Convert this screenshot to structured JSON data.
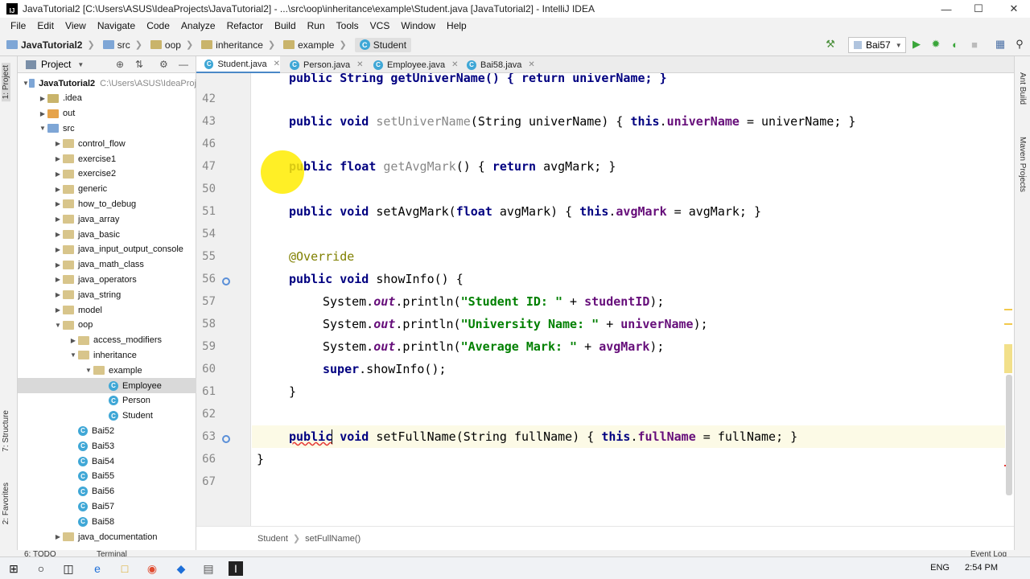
{
  "window": {
    "title": "JavaTutorial2 [C:\\Users\\ASUS\\IdeaProjects\\JavaTutorial2] - ...\\src\\oop\\inheritance\\example\\Student.java [JavaTutorial2] - IntelliJ IDEA",
    "app_icon_label": "IJ"
  },
  "menu": [
    "File",
    "Edit",
    "View",
    "Navigate",
    "Code",
    "Analyze",
    "Refactor",
    "Build",
    "Run",
    "Tools",
    "VCS",
    "Window",
    "Help"
  ],
  "navbar": {
    "crumbs": [
      "JavaTutorial2",
      "src",
      "oop",
      "inheritance",
      "example",
      "Student"
    ],
    "run_config": "Bai57"
  },
  "project_panel": {
    "title": "Project",
    "tree": [
      {
        "label": "JavaTutorial2",
        "suffix": "C:\\Users\\ASUS\\IdeaProj",
        "depth": 0,
        "type": "project",
        "open": true
      },
      {
        "label": ".idea",
        "depth": 1,
        "type": "dir",
        "open": false
      },
      {
        "label": "out",
        "depth": 1,
        "type": "orange",
        "open": false
      },
      {
        "label": "src",
        "depth": 1,
        "type": "src",
        "open": true
      },
      {
        "label": "control_flow",
        "depth": 2,
        "type": "pkg",
        "open": false
      },
      {
        "label": "exercise1",
        "depth": 2,
        "type": "pkg",
        "open": false
      },
      {
        "label": "exercise2",
        "depth": 2,
        "type": "pkg",
        "open": false
      },
      {
        "label": "generic",
        "depth": 2,
        "type": "pkg",
        "open": false
      },
      {
        "label": "how_to_debug",
        "depth": 2,
        "type": "pkg",
        "open": false
      },
      {
        "label": "java_array",
        "depth": 2,
        "type": "pkg",
        "open": false
      },
      {
        "label": "java_basic",
        "depth": 2,
        "type": "pkg",
        "open": false
      },
      {
        "label": "java_input_output_console",
        "depth": 2,
        "type": "pkg",
        "open": false
      },
      {
        "label": "java_math_class",
        "depth": 2,
        "type": "pkg",
        "open": false
      },
      {
        "label": "java_operators",
        "depth": 2,
        "type": "pkg",
        "open": false
      },
      {
        "label": "java_string",
        "depth": 2,
        "type": "pkg",
        "open": false
      },
      {
        "label": "model",
        "depth": 2,
        "type": "pkg",
        "open": false
      },
      {
        "label": "oop",
        "depth": 2,
        "type": "pkg",
        "open": true
      },
      {
        "label": "access_modifiers",
        "depth": 3,
        "type": "pkg",
        "open": false
      },
      {
        "label": "inheritance",
        "depth": 3,
        "type": "pkg",
        "open": true
      },
      {
        "label": "example",
        "depth": 4,
        "type": "pkg",
        "open": true
      },
      {
        "label": "Employee",
        "depth": 5,
        "type": "class",
        "selected": true
      },
      {
        "label": "Person",
        "depth": 5,
        "type": "class"
      },
      {
        "label": "Student",
        "depth": 5,
        "type": "class"
      },
      {
        "label": "Bai52",
        "depth": 3,
        "type": "class"
      },
      {
        "label": "Bai53",
        "depth": 3,
        "type": "class"
      },
      {
        "label": "Bai54",
        "depth": 3,
        "type": "class"
      },
      {
        "label": "Bai55",
        "depth": 3,
        "type": "class"
      },
      {
        "label": "Bai56",
        "depth": 3,
        "type": "class"
      },
      {
        "label": "Bai57",
        "depth": 3,
        "type": "class"
      },
      {
        "label": "Bai58",
        "depth": 3,
        "type": "class"
      },
      {
        "label": "java_documentation",
        "depth": 2,
        "type": "pkg",
        "open": false
      }
    ]
  },
  "tabs": [
    {
      "label": "Student.java",
      "active": true
    },
    {
      "label": "Person.java",
      "active": false
    },
    {
      "label": "Employee.java",
      "active": false
    },
    {
      "label": "Bai58.java",
      "active": false
    }
  ],
  "line_numbers": [
    "42",
    "43",
    "46",
    "47",
    "50",
    "51",
    "54",
    "55",
    "56",
    "57",
    "58",
    "59",
    "60",
    "61",
    "62",
    "63",
    "66",
    "67"
  ],
  "code": {
    "partial_top": "public String getUniverName() { return univerName; }",
    "l43": [
      "public",
      " ",
      "void",
      " ",
      "setUniverName",
      "(",
      "String",
      " univerName) { ",
      "this",
      ".",
      "univerName",
      " = univerName; }"
    ],
    "l47": [
      "public",
      " ",
      "float",
      " ",
      "getAvgMark",
      "() { ",
      "return",
      " avgMark; }"
    ],
    "l51": [
      "public",
      " ",
      "void",
      " setAvgMark(",
      "float",
      " avgMark) { ",
      "this",
      ".",
      "avgMark",
      " = avgMark; }"
    ],
    "l55": "@Override",
    "l56": [
      "public",
      " ",
      "void",
      " showInfo() {"
    ],
    "l57": [
      "System.",
      "out",
      ".println(",
      "\"Student ID: \"",
      " + ",
      "studentID",
      ");"
    ],
    "l58": [
      "System.",
      "out",
      ".println(",
      "\"University Name: \"",
      " + ",
      "univerName",
      ");"
    ],
    "l59": [
      "System.",
      "out",
      ".println(",
      "\"Average Mark: \"",
      " + ",
      "avgMark",
      ");"
    ],
    "l60": [
      "super",
      ".showInfo();"
    ],
    "l61": "}",
    "l63": [
      "public",
      " ",
      "void",
      " setFullName(String fullName) { ",
      "this",
      ".",
      "fullName",
      " = fullName; }"
    ],
    "l66": "}"
  },
  "editor_breadcrumb": [
    "Student",
    "setFullName()"
  ],
  "status_bar": {
    "left": "6: TODO",
    "middle": "Terminal",
    "right": "Event Log"
  },
  "left_strip_tabs": [
    "1: Project",
    "7: Structure",
    "2: Favorites"
  ],
  "right_strip_tabs": [
    "Ant Build",
    "Maven Projects"
  ],
  "taskbar": {
    "lang": "ENG",
    "time": "2:54 PM"
  },
  "colors": {
    "accent": "#4a88c7",
    "keyword": "#000080",
    "string": "#008000",
    "field": "#660e7a",
    "annotation": "#808000",
    "cursor_highlight": "#ffec00"
  }
}
